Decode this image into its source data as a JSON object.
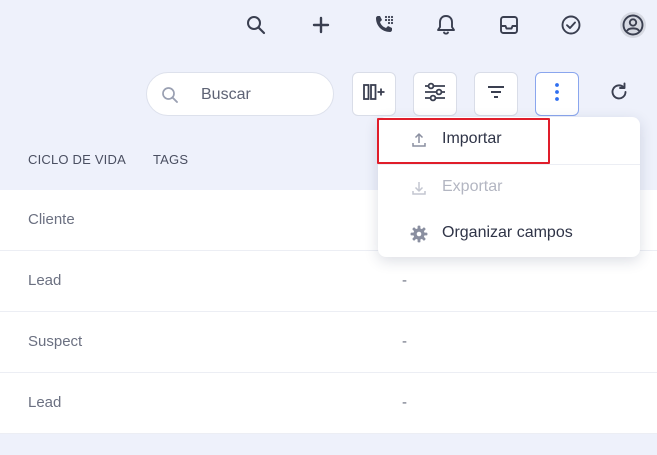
{
  "topbar": {
    "icons": [
      "search-icon",
      "plus-icon",
      "phone-dialpad-icon",
      "bell-icon",
      "inbox-icon",
      "check-circle-icon",
      "user-avatar-icon"
    ]
  },
  "search": {
    "placeholder": "Buscar",
    "value": ""
  },
  "toolbar": {
    "buttons": [
      "add-column-icon",
      "sliders-icon",
      "sort-lines-icon",
      "more-vertical-icon",
      "refresh-icon"
    ]
  },
  "columns": {
    "lifecycle": "CICLO DE VIDA",
    "tags": "TAGS"
  },
  "rows": [
    {
      "lifecycle": "Cliente",
      "tags": ""
    },
    {
      "lifecycle": "Lead",
      "tags": "-"
    },
    {
      "lifecycle": "Suspect",
      "tags": "-"
    },
    {
      "lifecycle": "Lead",
      "tags": "-"
    }
  ],
  "menu": {
    "items": [
      {
        "label": "Importar",
        "icon": "upload-icon",
        "enabled": true
      },
      {
        "label": "Exportar",
        "icon": "download-icon",
        "enabled": false
      },
      {
        "label": "Organizar campos",
        "icon": "gear-icon",
        "enabled": true
      }
    ]
  },
  "colors": {
    "accent": "#8aa6ee",
    "highlight": "#e01d2a",
    "background": "#eef1fb",
    "icon": "#4a4f61"
  }
}
